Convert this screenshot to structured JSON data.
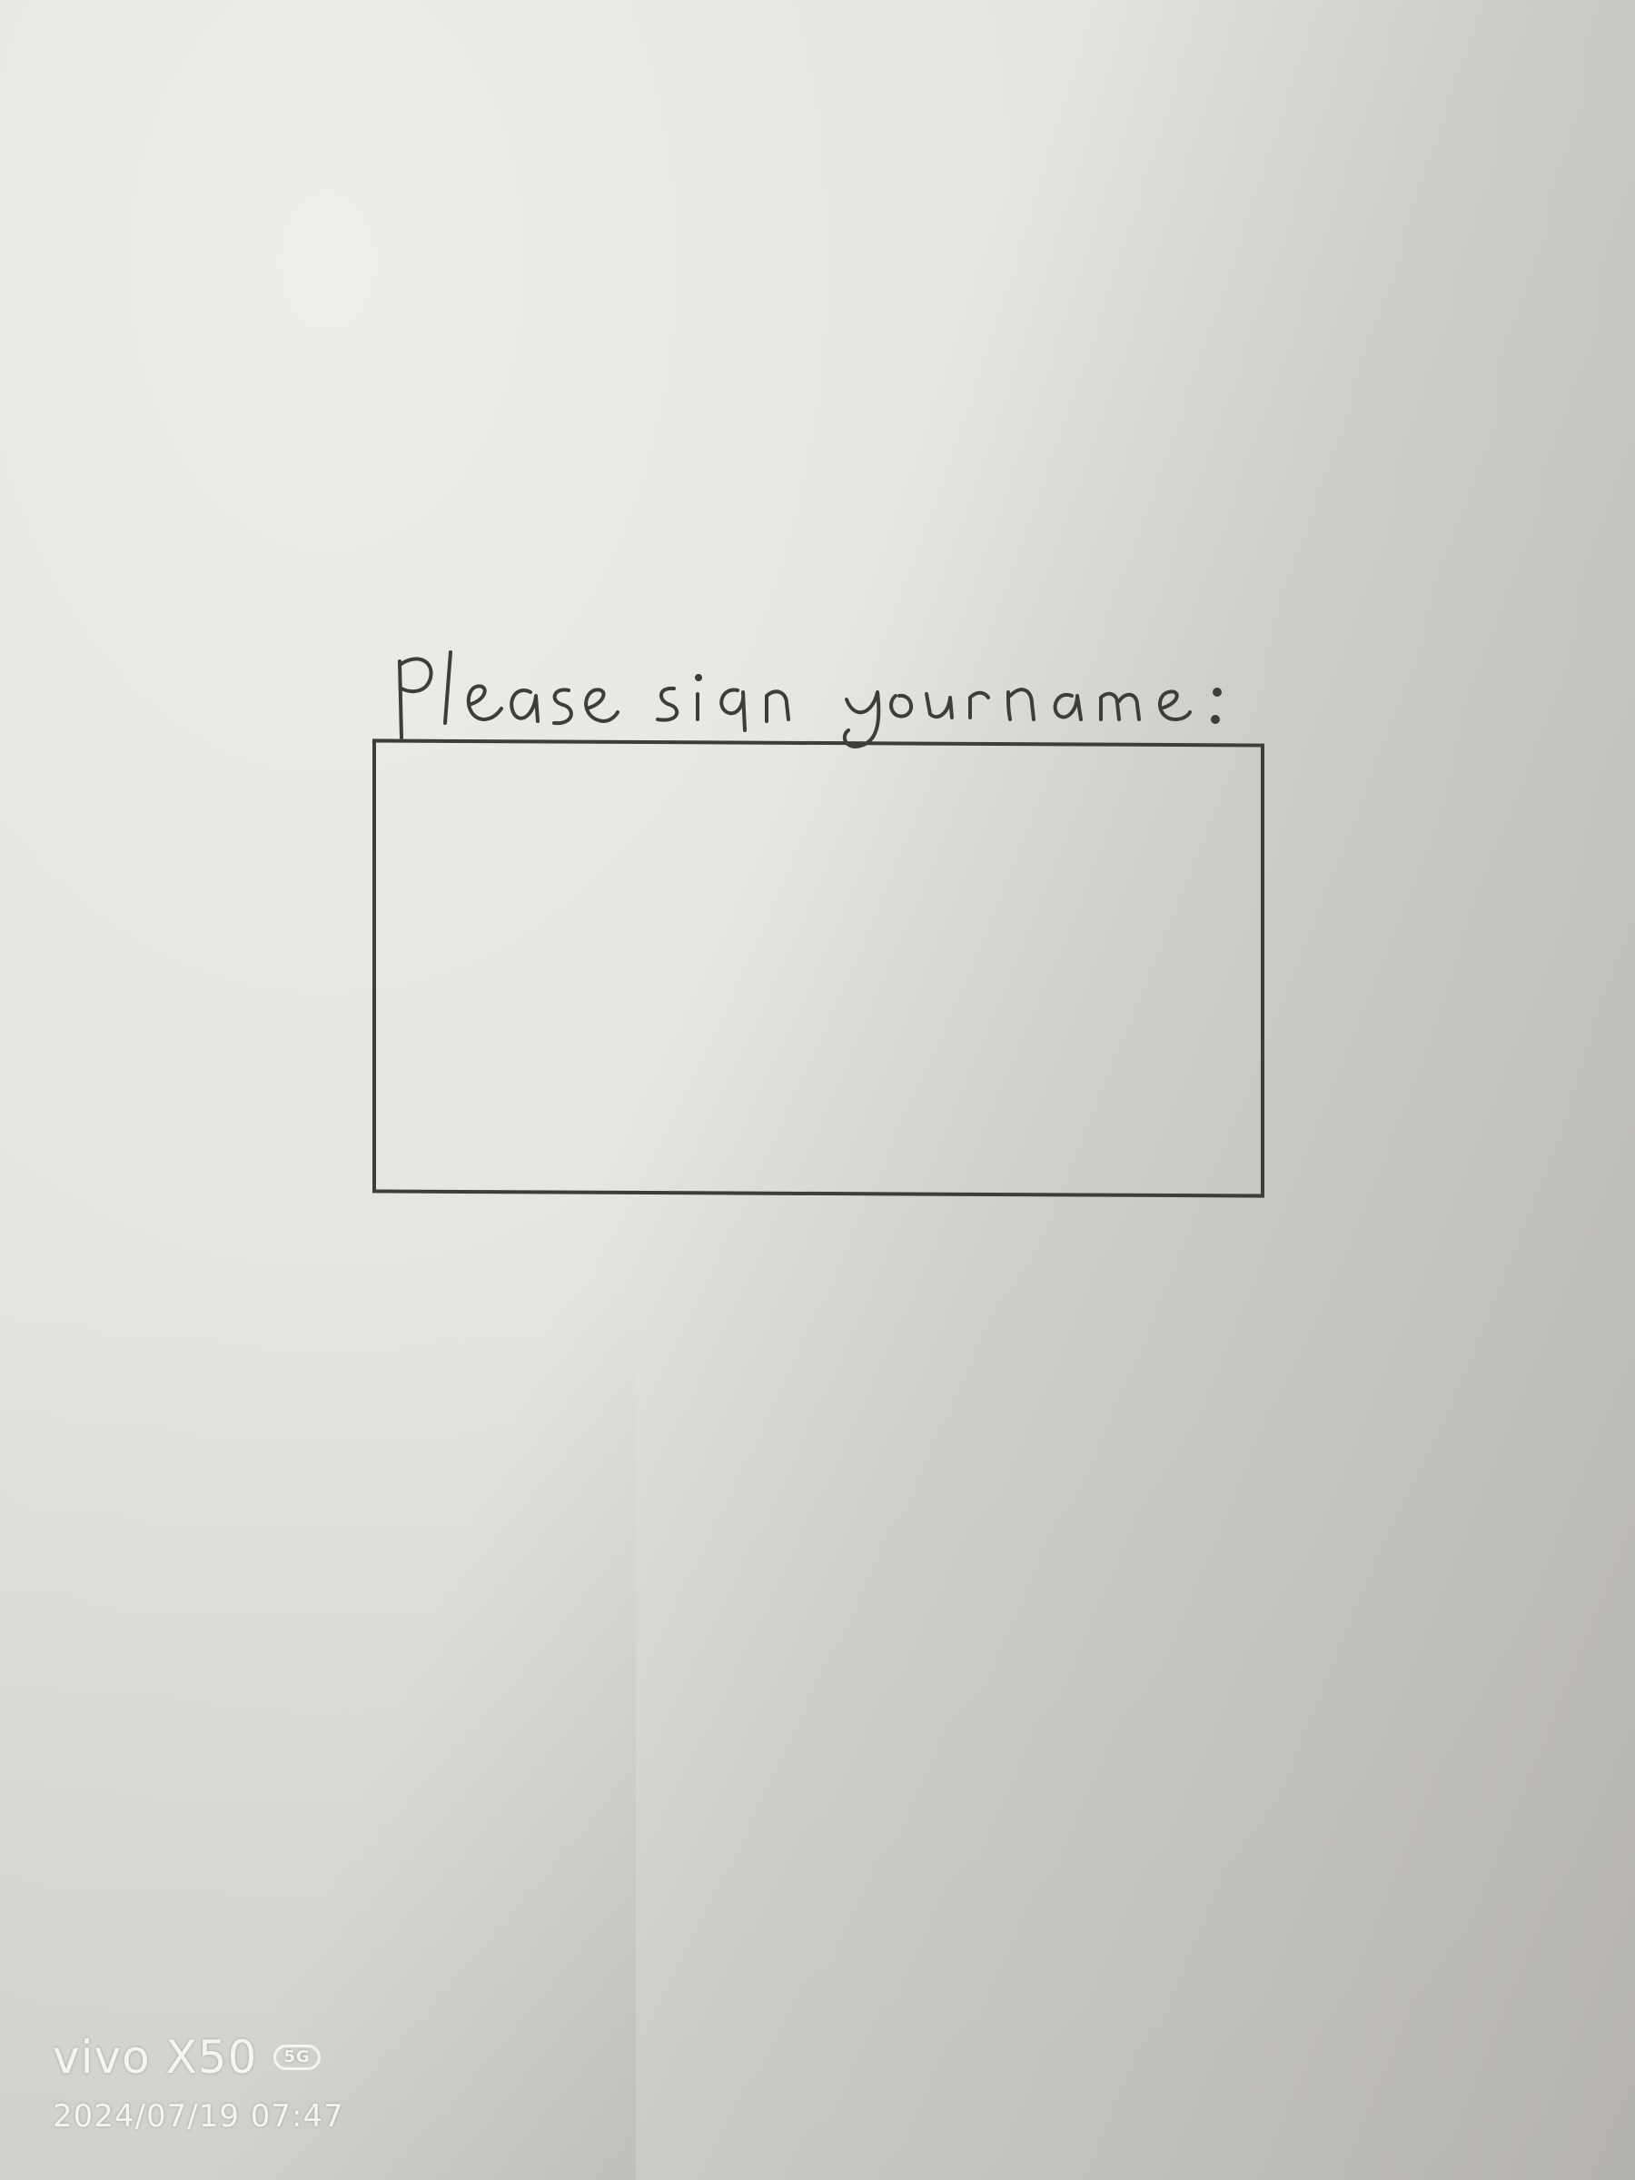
{
  "document": {
    "prompt_text": "please sign yourname:",
    "signature_value": ""
  },
  "camera_watermark": {
    "brand": "vivo X50",
    "badge": "5G",
    "datetime": "2024/07/19 07:47"
  },
  "colors": {
    "ink": "#3e3d3a",
    "paper": "#e4e4e0",
    "watermark": "#f4f4f2"
  }
}
